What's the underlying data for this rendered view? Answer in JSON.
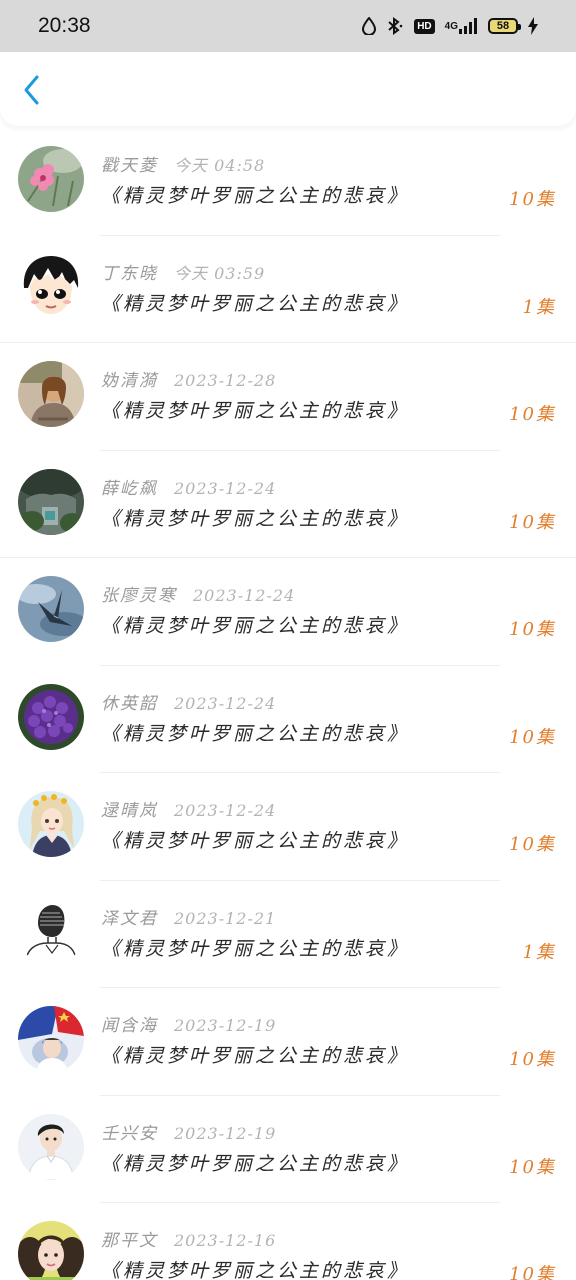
{
  "status_bar": {
    "time": "20:38",
    "hd_label": "HD",
    "network_label": "4G",
    "battery_level": "58"
  },
  "colors": {
    "back_accent": "#1a9be0",
    "count_accent": "#e07f2e"
  },
  "list": {
    "items": [
      {
        "name": "戳天菱",
        "time": "今天 04:58",
        "title": "《精灵梦叶罗丽之公主的悲哀》",
        "count": "10集",
        "avatar": "flower-avatar"
      },
      {
        "name": "丁东晓",
        "time": "今天 03:59",
        "title": "《精灵梦叶罗丽之公主的悲哀》",
        "count": "1集",
        "avatar": "cartoon-boy-avatar"
      },
      {
        "name": "妫清漪",
        "time": "2023-12-28",
        "title": "《精灵梦叶罗丽之公主的悲哀》",
        "count": "10集",
        "avatar": "girl-photo-avatar"
      },
      {
        "name": "薛屹飙",
        "time": "2023-12-24",
        "title": "《精灵梦叶罗丽之公主的悲哀》",
        "count": "10集",
        "avatar": "garden-photo-avatar"
      },
      {
        "name": "张廖灵寒",
        "time": "2023-12-24",
        "title": "《精灵梦叶罗丽之公主的悲哀》",
        "count": "10集",
        "avatar": "paper-crane-avatar"
      },
      {
        "name": "休英韶",
        "time": "2023-12-24",
        "title": "《精灵梦叶罗丽之公主的悲哀》",
        "count": "10集",
        "avatar": "purple-flower-avatar"
      },
      {
        "name": "逯晴岚",
        "time": "2023-12-24",
        "title": "《精灵梦叶罗丽之公主的悲哀》",
        "count": "10集",
        "avatar": "cartoon-girl-avatar"
      },
      {
        "name": "泽文君",
        "time": "2023-12-21",
        "title": "《精灵梦叶罗丽之公主的悲哀》",
        "count": "1集",
        "avatar": "sketch-avatar"
      },
      {
        "name": "闻含海",
        "time": "2023-12-19",
        "title": "《精灵梦叶罗丽之公主的悲哀》",
        "count": "10集",
        "avatar": "flag-boy-avatar"
      },
      {
        "name": "壬兴安",
        "time": "2023-12-19",
        "title": "《精灵梦叶罗丽之公主的悲哀》",
        "count": "10集",
        "avatar": "young-man-avatar"
      },
      {
        "name": "那平文",
        "time": "2023-12-16",
        "title": "《精灵梦叶罗丽之公主的悲哀》",
        "count": "10集",
        "avatar": "selfie-girl-avatar"
      }
    ]
  }
}
